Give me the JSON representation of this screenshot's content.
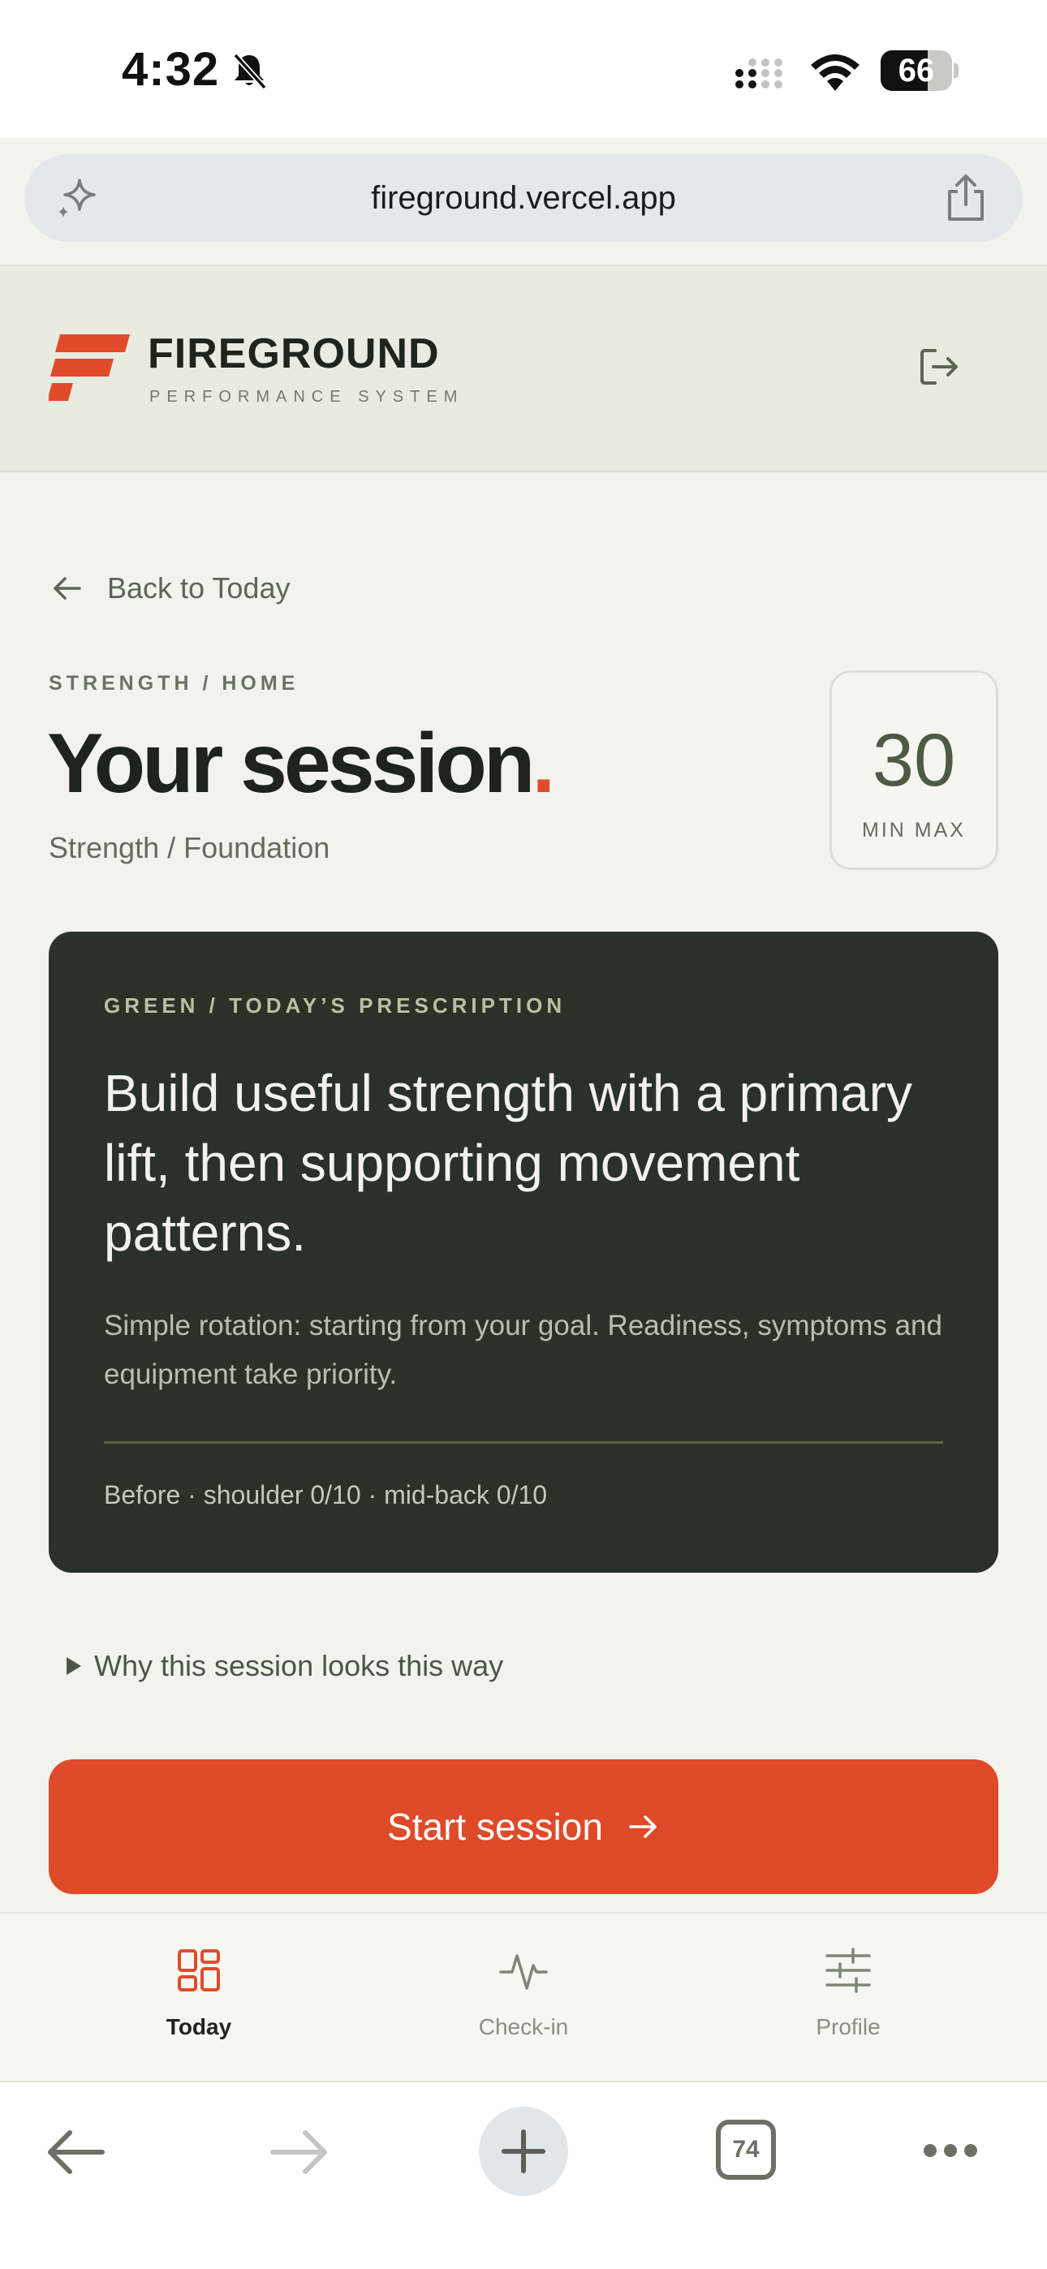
{
  "status_bar": {
    "time": "4:32",
    "battery": "66",
    "battery_level": 0.66
  },
  "browser": {
    "url": "fireground.vercel.app",
    "tab_count": "74"
  },
  "header": {
    "brand": "FIREGROUND",
    "tagline": "PERFORMANCE SYSTEM",
    "brand_color": "#e04b2a"
  },
  "nav": {
    "back_label": "Back to Today"
  },
  "session": {
    "eyebrow": "STRENGTH / HOME",
    "title": "Your session",
    "title_dot": ".",
    "subtitle": "Strength / Foundation",
    "duration_value": "30",
    "duration_label": "MIN MAX"
  },
  "prescription": {
    "eyebrow": "GREEN / TODAY’S PRESCRIPTION",
    "headline": "Build useful strength with a primary lift, then supporting movement patterns.",
    "body": "Simple rotation: starting from your goal. Readiness, symptoms and equipment take priority.",
    "footer": "Before · shoulder 0/10 · mid-back 0/10"
  },
  "why": {
    "label": "Why this session looks this way"
  },
  "start": {
    "label": "Start session",
    "color": "#df4a29"
  },
  "tabs": [
    {
      "label": "Today",
      "icon": "grid-icon",
      "active": true
    },
    {
      "label": "Check-in",
      "icon": "pulse-icon",
      "active": false
    },
    {
      "label": "Profile",
      "icon": "sliders-icon",
      "active": false
    }
  ]
}
